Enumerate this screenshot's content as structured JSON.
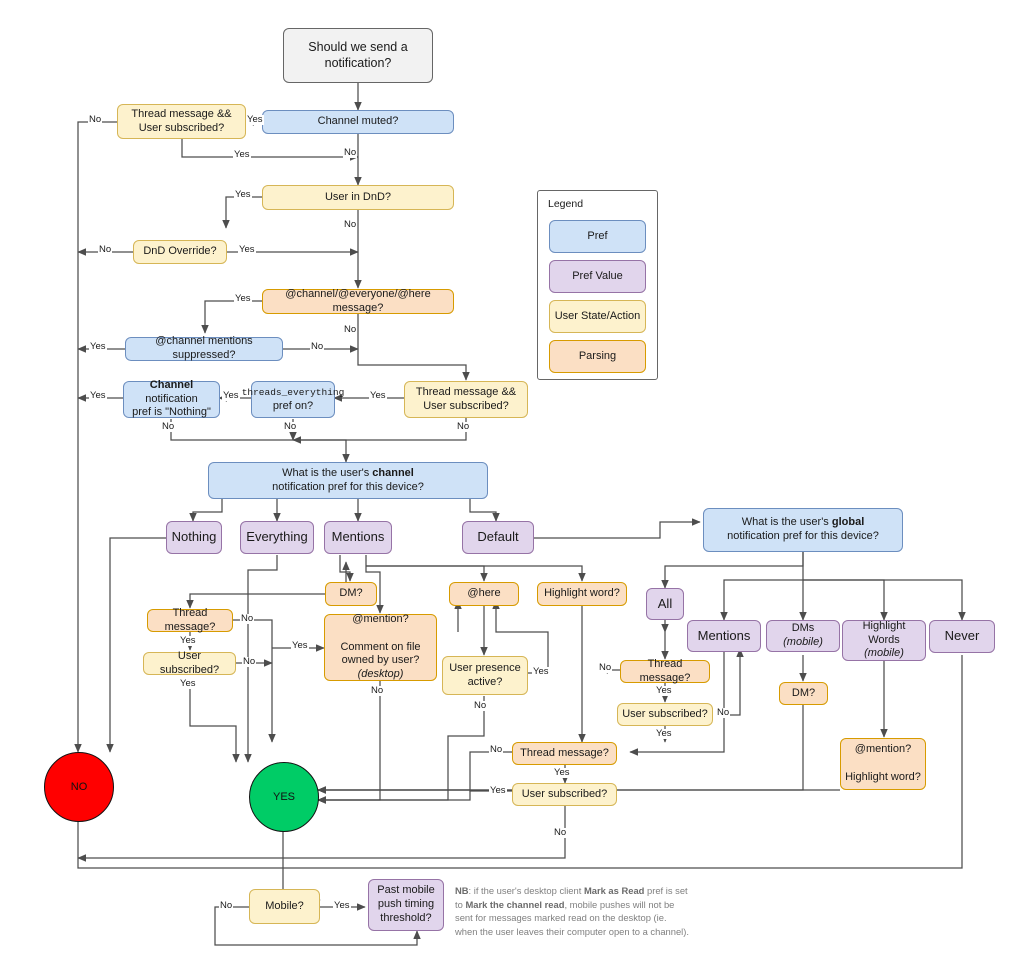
{
  "title": "Slack notification decision flowchart",
  "colors": {
    "pref_fill": "#cfe2f7",
    "pref_stroke": "#6c8ebf",
    "prefvalue_fill": "#e1d5ec",
    "prefvalue_stroke": "#9673a6",
    "userstate_fill": "#fdf2cd",
    "userstate_stroke": "#d6b656",
    "parsing_fill": "#fbdfc4",
    "parsing_stroke": "#d79b00",
    "start_fill": "#f2f2f2",
    "start_stroke": "#666666",
    "no_fill": "#ff0000",
    "yes_fill": "#00cc66",
    "edge": "#4d4d4d",
    "note_text": "#808080"
  },
  "legend": {
    "title": "Legend",
    "items": [
      {
        "label": "Pref",
        "type": "pref"
      },
      {
        "label": "Pref Value",
        "type": "prefvalue"
      },
      {
        "label": "User State/Action",
        "type": "userstate"
      },
      {
        "label": "Parsing",
        "type": "parsing"
      }
    ]
  },
  "nodes": {
    "start": "Should we send a notification?",
    "channel_muted": "Channel muted?",
    "thread_sub_1": "Thread message &amp;&amp; User subscribed?",
    "user_in_dnd": "User in DnD?",
    "dnd_override": "DnD Override?",
    "at_channel_msg": "@channel/@everyone/@here message?",
    "mentions_suppressed": "@channel mentions suppressed?",
    "thread_sub_2": "Thread message &amp;&amp; User subscribed?",
    "threads_everything": "threads_everything pref on?",
    "channel_pref_nothing": "Channel notification pref is \"Nothing\"",
    "channel_question": "What is the user's channel notification pref for this device?",
    "global_question": "What is the user's global notification pref for this device?",
    "val_nothing": "Nothing",
    "val_everything": "Everything",
    "val_mentions": "Mentions",
    "val_default": "Default",
    "val_all": "All",
    "val_g_mentions": "Mentions",
    "val_dms_mobile": "DMs (mobile)",
    "val_highlight_words_mobile": "Highlight Words (mobile)",
    "val_never": "Never",
    "dm_q": "DM?",
    "at_here": "@here",
    "highlight_word_q": "Highlight word?",
    "thread_message_a": "Thread message?",
    "user_subscribed_a": "User subscribed?",
    "at_mention_comment": "@mention? Comment on file owned by user? (desktop)",
    "user_presence_active": "User presence active?",
    "thread_message_b": "Thread message?",
    "user_subscribed_b": "User subscribed?",
    "thread_message_c": "Thread message?",
    "user_subscribed_c": "User subscribed?",
    "dm_q2": "DM?",
    "mention_highlight": "@mention? Highlight word?",
    "mobile_q": "Mobile?",
    "past_mobile_threshold": "Past mobile push timing threshold?",
    "terminal_no": "NO",
    "terminal_yes": "YES"
  },
  "node_text_parts": {
    "threads_everything_mono": "threads_everything",
    "threads_everything_rest": "pref on?",
    "channel_pref_bold": "Channel",
    "channel_pref_rest": "notification pref is \"Nothing\"",
    "channel_q_line1_pre": "What is the user's ",
    "channel_q_line1_bold": "channel",
    "channel_q_line2": "notification pref for this device?",
    "global_q_line1_pre": "What is the user's ",
    "global_q_line1_bold": "global",
    "global_q_line2": "notification pref for this device?",
    "dms_mobile_main": "DMs ",
    "dms_mobile_it": "(mobile)",
    "hw_main": "Highlight Words",
    "hw_it": "(mobile)",
    "mention_line1": "@mention?",
    "mention_line2_pre": "Comment on file owned by user? ",
    "mention_line2_it": "(desktop)",
    "mh_line1": "@mention?",
    "mh_line2": "Highlight word?"
  },
  "edge_labels": [
    "Yes",
    "No",
    "Yes",
    "No",
    "Yes",
    "No",
    "Yes",
    "Yes",
    "No",
    "Yes",
    "No",
    "No",
    "Yes",
    "Yes",
    "No",
    "Yes",
    "No",
    "No",
    "No",
    "Yes",
    "No",
    "Yes",
    "Yes",
    "No",
    "Yes",
    "No",
    "Yes",
    "Yes",
    "No",
    "Yes",
    "No",
    "No",
    "Yes",
    "No",
    "Yes",
    "No",
    "Yes"
  ],
  "note": {
    "nb": "NB",
    "part1": ": if the user's desktop client ",
    "bold1": "Mark as Read",
    "part2": " pref is set to ",
    "bold2": "Mark the channel read",
    "part3": ", mobile pushes will not be sent for messages marked read on the desktop (ie. when the user leaves their computer open to a channel)."
  }
}
